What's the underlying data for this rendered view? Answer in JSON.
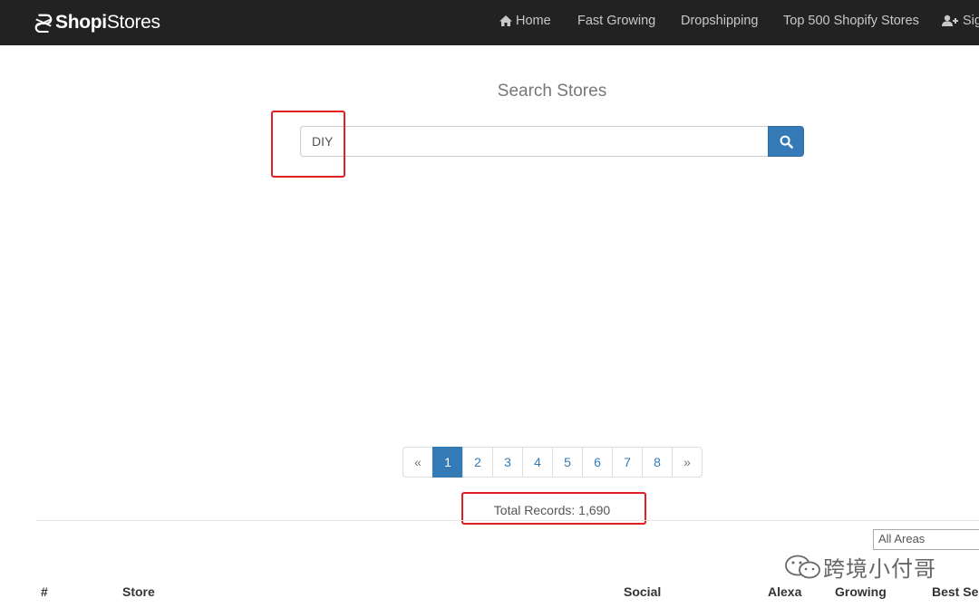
{
  "navbar": {
    "brand_bold": "Shopi",
    "brand_light": "Stores",
    "items": [
      {
        "label": "Home"
      },
      {
        "label": "Fast Growing"
      },
      {
        "label": "Dropshipping"
      },
      {
        "label": "Top 500 Shopify Stores"
      },
      {
        "label": "Sig"
      }
    ]
  },
  "search": {
    "title": "Search Stores",
    "value": "DIY"
  },
  "pagination": {
    "prev": "«",
    "pages": [
      "1",
      "2",
      "3",
      "4",
      "5",
      "6",
      "7",
      "8"
    ],
    "active": "1",
    "next": "»"
  },
  "total_records": "Total Records: 1,690",
  "filter": {
    "area_selected": "All Areas"
  },
  "table": {
    "headers": [
      "#",
      "Store",
      "Social",
      "Alexa",
      "Growing",
      "Best Se"
    ]
  },
  "watermark": "跨境小付哥",
  "colors": {
    "navbar_bg": "#222222",
    "primary": "#337ab7",
    "highlight_red": "#e02020"
  }
}
